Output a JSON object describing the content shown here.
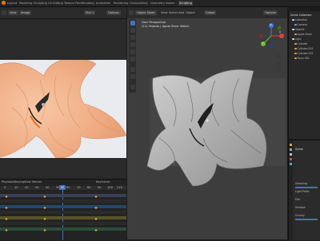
{
  "workspace_tabs": [
    "Layout",
    "Modeling",
    "Sculpting",
    "UV Editing",
    "Texture Paint",
    "Shading",
    "Animation",
    "Rendering",
    "Compositing",
    "Geometry Nodes",
    "Scripting"
  ],
  "active_tab_index": 0,
  "image_editor": {
    "view_label": "View",
    "image_label": "Image",
    "slot_label": "Slot 1",
    "options_label": "Options"
  },
  "viewport": {
    "mode_label": "Object Mode",
    "menus": [
      "View",
      "Select",
      "Add",
      "Object"
    ],
    "transform_label": "Global",
    "options_label": "Options",
    "perspective_label": "User Perspective",
    "object_label": "(12) Objects | Apple Shoe: Watch",
    "gizmo": {
      "x": "X",
      "y": "Y",
      "z": "Z"
    }
  },
  "outliner": {
    "title": "Scene Collection",
    "items": [
      "Collection",
      "Camera",
      "Objects",
      "Apple Shoe",
      "Light",
      "Cylinder",
      "Cylinder.001",
      "Cylinder.002",
      "Torus.001"
    ]
  },
  "timeline": {
    "menus": [
      "Playback",
      "Keying",
      "View",
      "Marker"
    ],
    "frame_numbers": [
      "0",
      "10",
      "20",
      "30",
      "40",
      "50",
      "60",
      "70",
      "80",
      "90",
      "100",
      "110"
    ],
    "current_frame": "42",
    "frame_field_label": "Keyframe"
  },
  "properties": {
    "tab_label": "Scene",
    "sections": [
      "Sampling",
      "Light Paths",
      "Film",
      "Shadow",
      "Gravity"
    ]
  },
  "colors": {
    "accent": "#4772b3",
    "cloth_render": "#f1b28c",
    "keyframe": "#e4b43a",
    "x_axis": "#e53f3f",
    "y_axis": "#6bbf2a",
    "z_axis": "#3f7be5"
  }
}
